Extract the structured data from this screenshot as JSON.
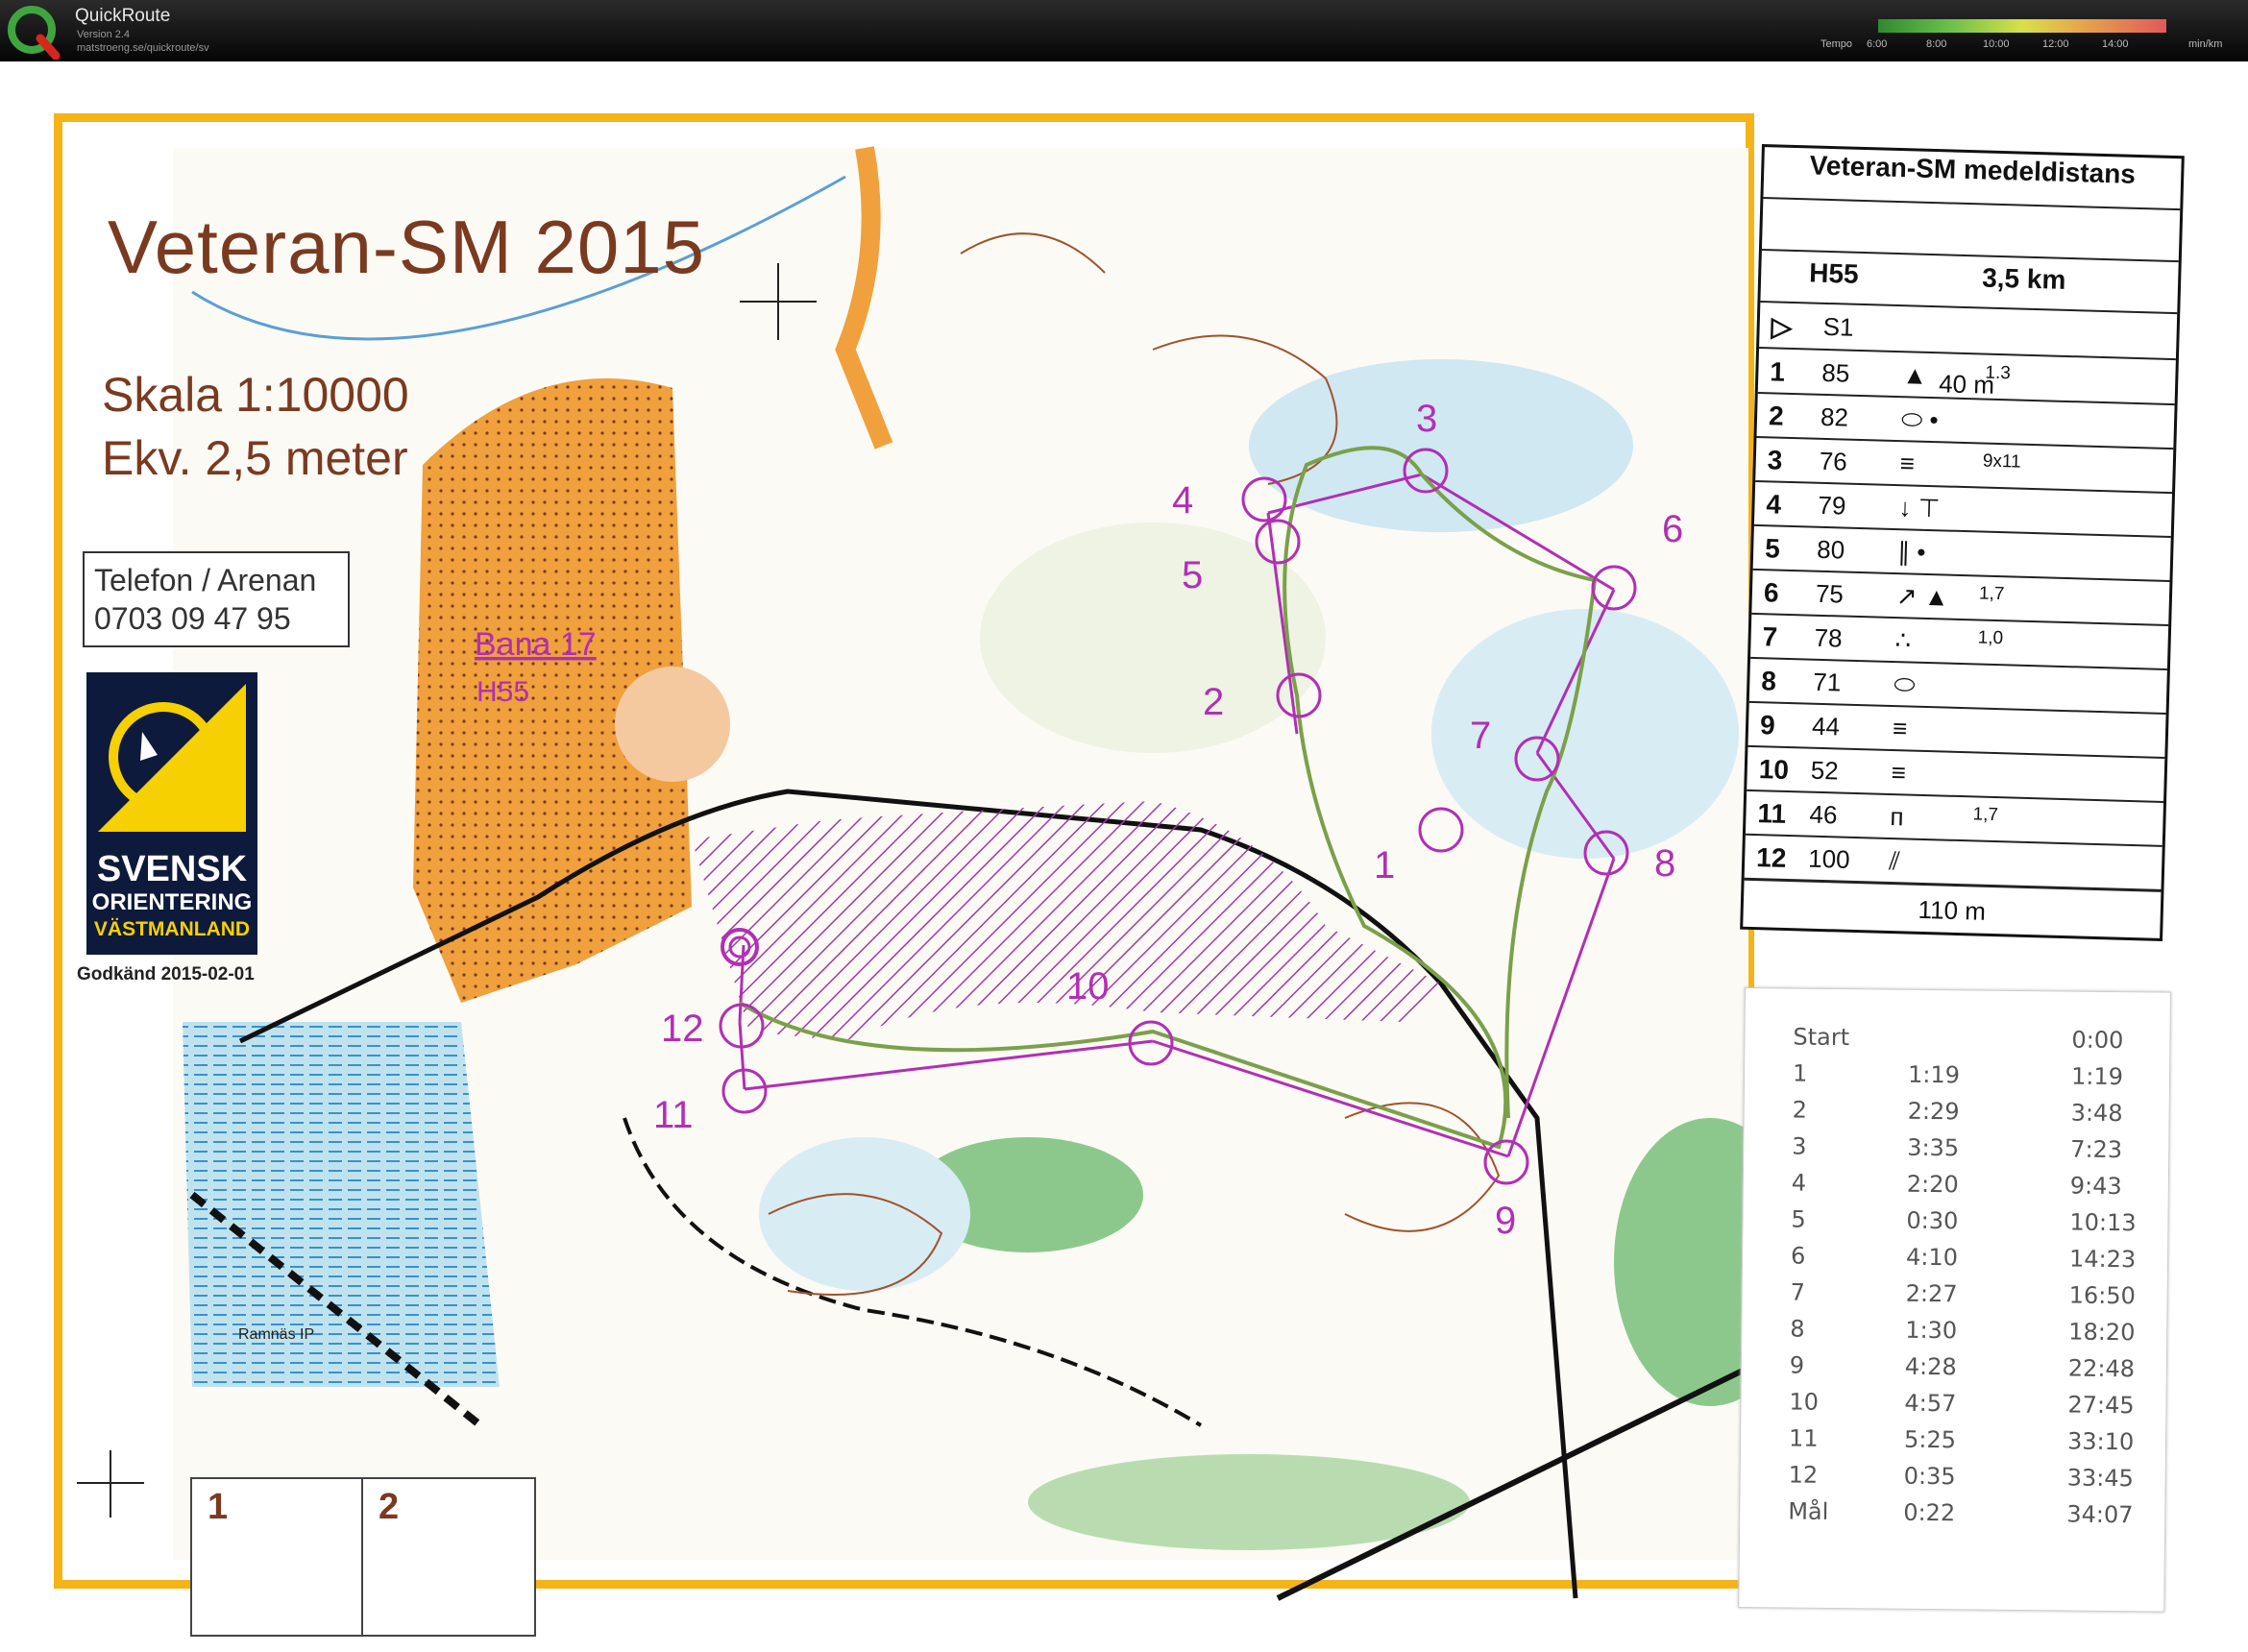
{
  "app": {
    "name": "QuickRoute",
    "version": "Version 2.4",
    "url": "matstroeng.se/quickroute/sv",
    "tempo_label": "Tempo",
    "tempo_ticks": [
      "6:00",
      "8:00",
      "10:00",
      "12:00",
      "14:00"
    ],
    "tempo_unit": "min/km"
  },
  "map": {
    "title": "Veteran-SM 2015",
    "scale": "Skala 1:10000",
    "equidistance": "Ekv. 2,5 meter",
    "phone_label": "Telefon / Arenan",
    "phone_number": "0703 09 47 95",
    "course_label": "Bana 17",
    "course_class": "H55",
    "logo": {
      "line1": "SVENSK",
      "line2": "ORIENTERING",
      "line3": "VÄSTMANLAND"
    },
    "approved": "Godkänd 2015-02-01",
    "place_label": "Ramnäs IP",
    "lap_boxes": [
      "1",
      "2"
    ],
    "control_numbers": [
      "1",
      "2",
      "3",
      "4",
      "5",
      "6",
      "7",
      "8",
      "9",
      "10",
      "11",
      "12"
    ],
    "colors": {
      "frame": "#f4b418",
      "course": "#b12fb5",
      "route": "#7aa04a",
      "text": "#7a3a20"
    }
  },
  "description": {
    "title": "Veteran-SM  medeldistans",
    "class": "H55",
    "length": "3,5 km",
    "start_distance": "40 m",
    "start_label": "S1",
    "controls": [
      {
        "num": "1",
        "code": "85",
        "dim": "1.3",
        "symbol": "▲"
      },
      {
        "num": "2",
        "code": "82",
        "dim": "",
        "symbol": "⬭ •"
      },
      {
        "num": "3",
        "code": "76",
        "dim": "9x11",
        "symbol": "≡"
      },
      {
        "num": "4",
        "code": "79",
        "dim": "",
        "symbol": "↓ ⊤"
      },
      {
        "num": "5",
        "code": "80",
        "dim": "",
        "symbol": "∥ •"
      },
      {
        "num": "6",
        "code": "75",
        "dim": "1,7",
        "symbol": "↗ ▲"
      },
      {
        "num": "7",
        "code": "78",
        "dim": "1,0",
        "symbol": "∴"
      },
      {
        "num": "8",
        "code": "71",
        "dim": "",
        "symbol": "⬭"
      },
      {
        "num": "9",
        "code": "44",
        "dim": "",
        "symbol": "≡"
      },
      {
        "num": "10",
        "code": "52",
        "dim": "",
        "symbol": "≡"
      },
      {
        "num": "11",
        "code": "46",
        "dim": "1,7",
        "symbol": "ᴨ"
      },
      {
        "num": "12",
        "code": "100",
        "dim": "",
        "symbol": "⫽"
      }
    ],
    "finish_distance": "110 m"
  },
  "splits": [
    {
      "label": "Start",
      "split": "",
      "total": "0:00"
    },
    {
      "label": "1",
      "split": "1:19",
      "total": "1:19"
    },
    {
      "label": "2",
      "split": "2:29",
      "total": "3:48"
    },
    {
      "label": "3",
      "split": "3:35",
      "total": "7:23"
    },
    {
      "label": "4",
      "split": "2:20",
      "total": "9:43"
    },
    {
      "label": "5",
      "split": "0:30",
      "total": "10:13"
    },
    {
      "label": "6",
      "split": "4:10",
      "total": "14:23"
    },
    {
      "label": "7",
      "split": "2:27",
      "total": "16:50"
    },
    {
      "label": "8",
      "split": "1:30",
      "total": "18:20"
    },
    {
      "label": "9",
      "split": "4:28",
      "total": "22:48"
    },
    {
      "label": "10",
      "split": "4:57",
      "total": "27:45"
    },
    {
      "label": "11",
      "split": "5:25",
      "total": "33:10"
    },
    {
      "label": "12",
      "split": "0:35",
      "total": "33:45"
    },
    {
      "label": "Mål",
      "split": "0:22",
      "total": "34:07"
    }
  ]
}
